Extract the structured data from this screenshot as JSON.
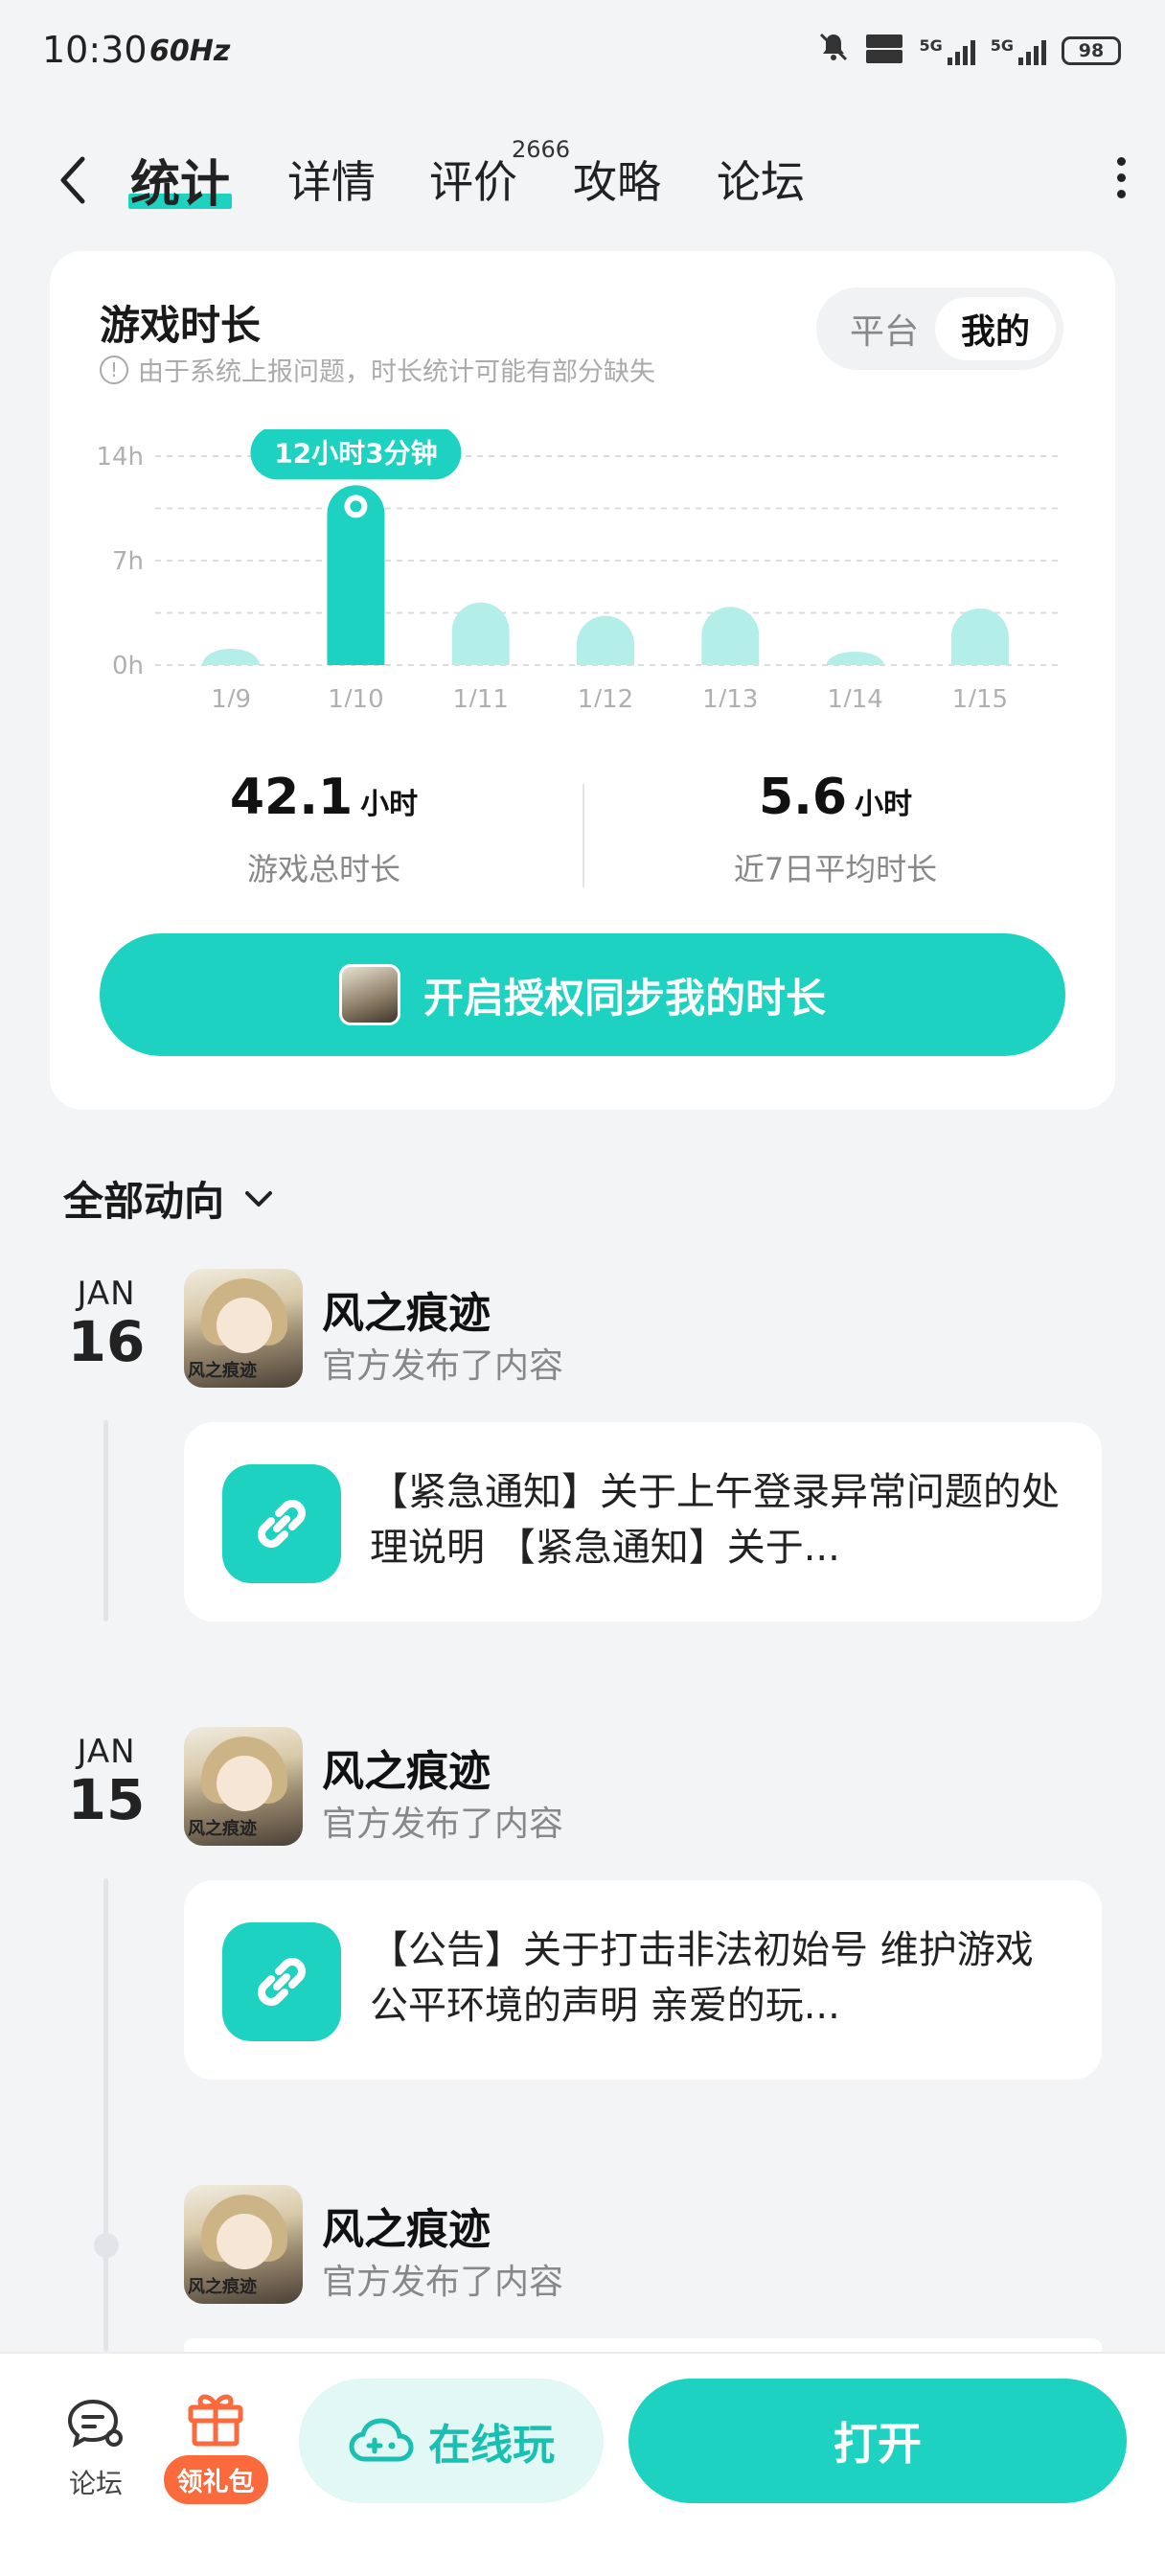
{
  "status_bar": {
    "time": "10:30",
    "refresh": "60Hz",
    "sig1_label": "5G",
    "sig2_label": "5G",
    "battery": "98",
    "icons": [
      "mute-icon",
      "hd-icon",
      "signal-icon",
      "signal-icon",
      "battery-icon"
    ]
  },
  "header": {
    "tabs": [
      {
        "label": "统计",
        "active": true
      },
      {
        "label": "详情"
      },
      {
        "label": "评价",
        "badge": "2666"
      },
      {
        "label": "攻略"
      },
      {
        "label": "论坛"
      }
    ]
  },
  "stats_card": {
    "title": "游戏时长",
    "note": "由于系统上报问题，时长统计可能有部分缺失",
    "toggle": {
      "platform": "平台",
      "mine": "我的",
      "selected": "我的"
    },
    "tooltip": "12小时3分钟",
    "summary": [
      {
        "value": "42.1",
        "unit": "小时",
        "label": "游戏总时长"
      },
      {
        "value": "5.6",
        "unit": "小时",
        "label": "近7日平均时长"
      }
    ],
    "sync_button": "开启授权同步我的时长"
  },
  "chart_data": {
    "type": "bar",
    "categories": [
      "1/9",
      "1/10",
      "1/11",
      "1/12",
      "1/13",
      "1/14",
      "1/15"
    ],
    "values": [
      1.1,
      12.05,
      4.2,
      3.3,
      3.9,
      0.9,
      3.8
    ],
    "highlight_index": 1,
    "ylim": [
      0,
      14
    ],
    "yticks": [
      "0h",
      "7h",
      "14h"
    ],
    "grid": true,
    "colors": {
      "bar": "#b3efe8",
      "highlight": "#1dd2c1"
    }
  },
  "feed": {
    "title": "全部动向",
    "posts": [
      {
        "month": "JAN",
        "day": "16",
        "author": "风之痕迹",
        "action": "官方发布了内容",
        "text": "【紧急通知】关于上午登录异常问题的处理说明 【紧急通知】关于..."
      },
      {
        "month": "JAN",
        "day": "15",
        "author": "风之痕迹",
        "action": "官方发布了内容",
        "text": "【公告】关于打击非法初始号 维护游戏公平环境的声明 亲爱的玩..."
      },
      {
        "author": "风之痕迹",
        "action": "官方发布了内容"
      }
    ],
    "avatar_caption": "风之痕迹"
  },
  "bottom_bar": {
    "forum": "论坛",
    "gift": "领礼包",
    "cloud_play": "在线玩",
    "open": "打开"
  },
  "colors": {
    "accent": "#1dd2c1",
    "accent_light": "#b3efe8",
    "gift": "#fa6a3c"
  }
}
